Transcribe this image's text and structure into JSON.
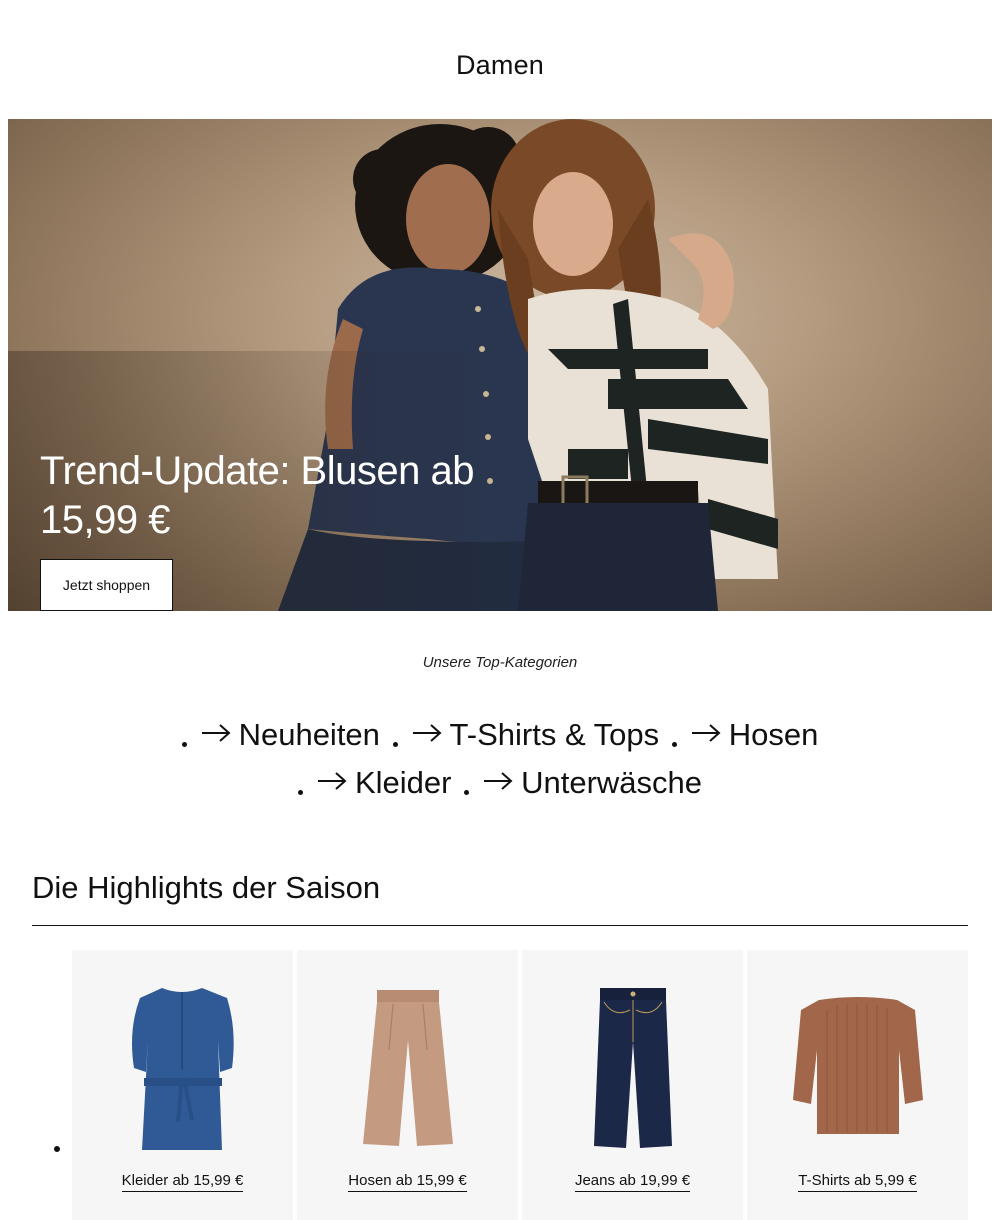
{
  "page": {
    "title": "Damen"
  },
  "hero": {
    "heading": "Trend-Update: Blusen ab 15,99 €",
    "cta_label": "Jetzt shoppen"
  },
  "categories": {
    "heading": "Unsere Top-Kategorien",
    "items": [
      {
        "label": "Neuheiten",
        "icon": "arrow-right-icon"
      },
      {
        "label": "T-Shirts & Tops",
        "icon": "arrow-right-icon"
      },
      {
        "label": "Hosen",
        "icon": "arrow-right-icon"
      },
      {
        "label": "Kleider",
        "icon": "arrow-right-icon"
      },
      {
        "label": "Unterwäsche",
        "icon": "arrow-right-icon"
      }
    ]
  },
  "highlights": {
    "title": "Die Highlights der Saison",
    "products": [
      {
        "label": "Kleider ab 15,99 €",
        "image": "denim-dress"
      },
      {
        "label": "Hosen ab 15,99 €",
        "image": "beige-wide-trousers"
      },
      {
        "label": "Jeans ab 19,99 €",
        "image": "dark-wide-jeans"
      },
      {
        "label": "T-Shirts ab 5,99 €",
        "image": "rust-pleated-top"
      }
    ]
  },
  "colors": {
    "text": "#111111",
    "hero_background": "#b49b80",
    "product_tile": "#f6f6f6"
  }
}
